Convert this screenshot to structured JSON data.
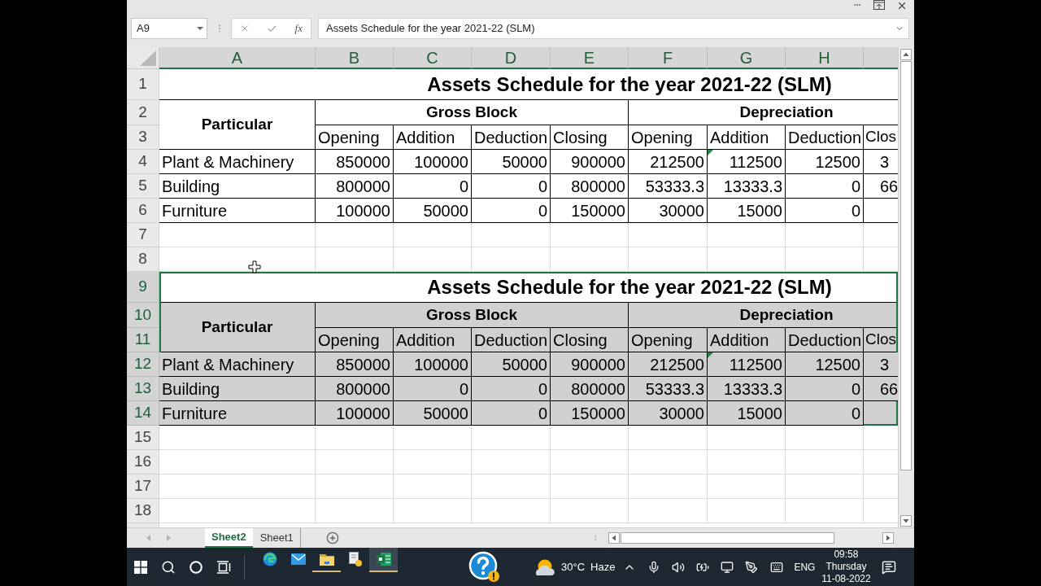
{
  "formula_bar": {
    "name_box": "A9",
    "function_label": "fx",
    "formula": "Assets Schedule for the year 2021-22 (SLM)"
  },
  "columns": [
    {
      "label": "A",
      "selected": true
    },
    {
      "label": "B",
      "selected": true
    },
    {
      "label": "C",
      "selected": true
    },
    {
      "label": "D",
      "selected": true
    },
    {
      "label": "E",
      "selected": true
    },
    {
      "label": "F",
      "selected": true
    },
    {
      "label": "G",
      "selected": true
    },
    {
      "label": "H",
      "selected": true
    }
  ],
  "grid": [
    {
      "kind": "table",
      "selected": false,
      "row_headers": [
        {
          "label": "1",
          "selected": false
        },
        {
          "label": "2",
          "selected": false
        },
        {
          "label": "3",
          "selected": false
        },
        {
          "label": "4",
          "selected": false
        },
        {
          "label": "5",
          "selected": false
        },
        {
          "label": "6",
          "selected": false
        }
      ],
      "title": "Assets Schedule for the year 2021-22 (SLM)",
      "particular": "Particular",
      "groups": [
        {
          "label": "Gross Block"
        },
        {
          "label": "Depreciation"
        }
      ],
      "subheaders": [
        "Opening",
        "Addition",
        "Deduction",
        "Closing",
        "Opening",
        "Addition",
        "Deduction",
        "Clos"
      ],
      "rows": [
        {
          "cells": [
            {
              "text": "Plant & Machinery",
              "flagged": false
            },
            {
              "text": "850000",
              "flagged": false
            },
            {
              "text": "100000",
              "flagged": false
            },
            {
              "text": "50000",
              "flagged": false
            },
            {
              "text": "900000",
              "flagged": false
            },
            {
              "text": "212500",
              "flagged": false
            },
            {
              "text": "112500",
              "flagged": true
            },
            {
              "text": "12500",
              "flagged": false
            },
            {
              "text": "3",
              "flagged": false
            }
          ]
        },
        {
          "cells": [
            {
              "text": "Building",
              "flagged": false
            },
            {
              "text": "800000",
              "flagged": false
            },
            {
              "text": "0",
              "flagged": false
            },
            {
              "text": "0",
              "flagged": false
            },
            {
              "text": "800000",
              "flagged": false
            },
            {
              "text": "53333.3",
              "flagged": false
            },
            {
              "text": "13333.3",
              "flagged": false
            },
            {
              "text": "0",
              "flagged": false
            },
            {
              "text": "66",
              "flagged": false
            }
          ]
        },
        {
          "cells": [
            {
              "text": "Furniture",
              "flagged": false
            },
            {
              "text": "100000",
              "flagged": false
            },
            {
              "text": "50000",
              "flagged": false
            },
            {
              "text": "0",
              "flagged": false
            },
            {
              "text": "150000",
              "flagged": false
            },
            {
              "text": "30000",
              "flagged": false
            },
            {
              "text": "15000",
              "flagged": false
            },
            {
              "text": "0",
              "flagged": false
            }
          ]
        }
      ]
    },
    {
      "kind": "blank",
      "row_headers": [
        {
          "label": "7",
          "selected": false
        },
        {
          "label": "8",
          "selected": false
        }
      ]
    },
    {
      "kind": "table",
      "selected": true,
      "row_headers": [
        {
          "label": "9",
          "selected": true
        },
        {
          "label": "10",
          "selected": true
        },
        {
          "label": "11",
          "selected": true
        },
        {
          "label": "12",
          "selected": true
        },
        {
          "label": "13",
          "selected": true
        },
        {
          "label": "14",
          "selected": true
        }
      ],
      "title": "Assets Schedule for the year 2021-22 (SLM)",
      "particular": "Particular",
      "groups": [
        {
          "label": "Gross Block"
        },
        {
          "label": "Depreciation"
        }
      ],
      "subheaders": [
        "Opening",
        "Addition",
        "Deduction",
        "Closing",
        "Opening",
        "Addition",
        "Deduction",
        "Clos"
      ],
      "rows": [
        {
          "cells": [
            {
              "text": "Plant & Machinery",
              "flagged": false
            },
            {
              "text": "850000",
              "flagged": false
            },
            {
              "text": "100000",
              "flagged": false
            },
            {
              "text": "50000",
              "flagged": false
            },
            {
              "text": "900000",
              "flagged": false
            },
            {
              "text": "212500",
              "flagged": false
            },
            {
              "text": "112500",
              "flagged": true
            },
            {
              "text": "12500",
              "flagged": false
            },
            {
              "text": "3",
              "flagged": false
            }
          ]
        },
        {
          "cells": [
            {
              "text": "Building",
              "flagged": false
            },
            {
              "text": "800000",
              "flagged": false
            },
            {
              "text": "0",
              "flagged": false
            },
            {
              "text": "0",
              "flagged": false
            },
            {
              "text": "800000",
              "flagged": false
            },
            {
              "text": "53333.3",
              "flagged": false
            },
            {
              "text": "13333.3",
              "flagged": false
            },
            {
              "text": "0",
              "flagged": false
            },
            {
              "text": "66",
              "flagged": false
            }
          ]
        },
        {
          "cells": [
            {
              "text": "Furniture",
              "flagged": false
            },
            {
              "text": "100000",
              "flagged": false
            },
            {
              "text": "50000",
              "flagged": false
            },
            {
              "text": "0",
              "flagged": false
            },
            {
              "text": "150000",
              "flagged": false
            },
            {
              "text": "30000",
              "flagged": false
            },
            {
              "text": "15000",
              "flagged": false
            },
            {
              "text": "0",
              "flagged": false
            }
          ]
        }
      ]
    },
    {
      "kind": "blank",
      "row_headers": [
        {
          "label": "15",
          "selected": false
        },
        {
          "label": "16",
          "selected": false
        },
        {
          "label": "17",
          "selected": false
        },
        {
          "label": "18",
          "selected": false
        }
      ]
    }
  ],
  "sheet_tabs": [
    {
      "label": "Sheet2",
      "selected": true
    },
    {
      "label": "Sheet1",
      "selected": false
    }
  ],
  "taskbar": {
    "apps": [
      {
        "kind": "browser",
        "selected": false,
        "running": false
      },
      {
        "kind": "mail",
        "selected": false,
        "running": false
      },
      {
        "kind": "folder",
        "selected": false,
        "running": true
      },
      {
        "kind": "document",
        "selected": false,
        "running": false
      },
      {
        "kind": "spreadsheet",
        "selected": true,
        "running": true
      }
    ],
    "weather": {
      "temperature": "30°C",
      "condition": "Haze"
    },
    "language": "ENG",
    "clock": {
      "time": "09:58",
      "day": "Thursday",
      "date": "11-08-2022"
    }
  }
}
